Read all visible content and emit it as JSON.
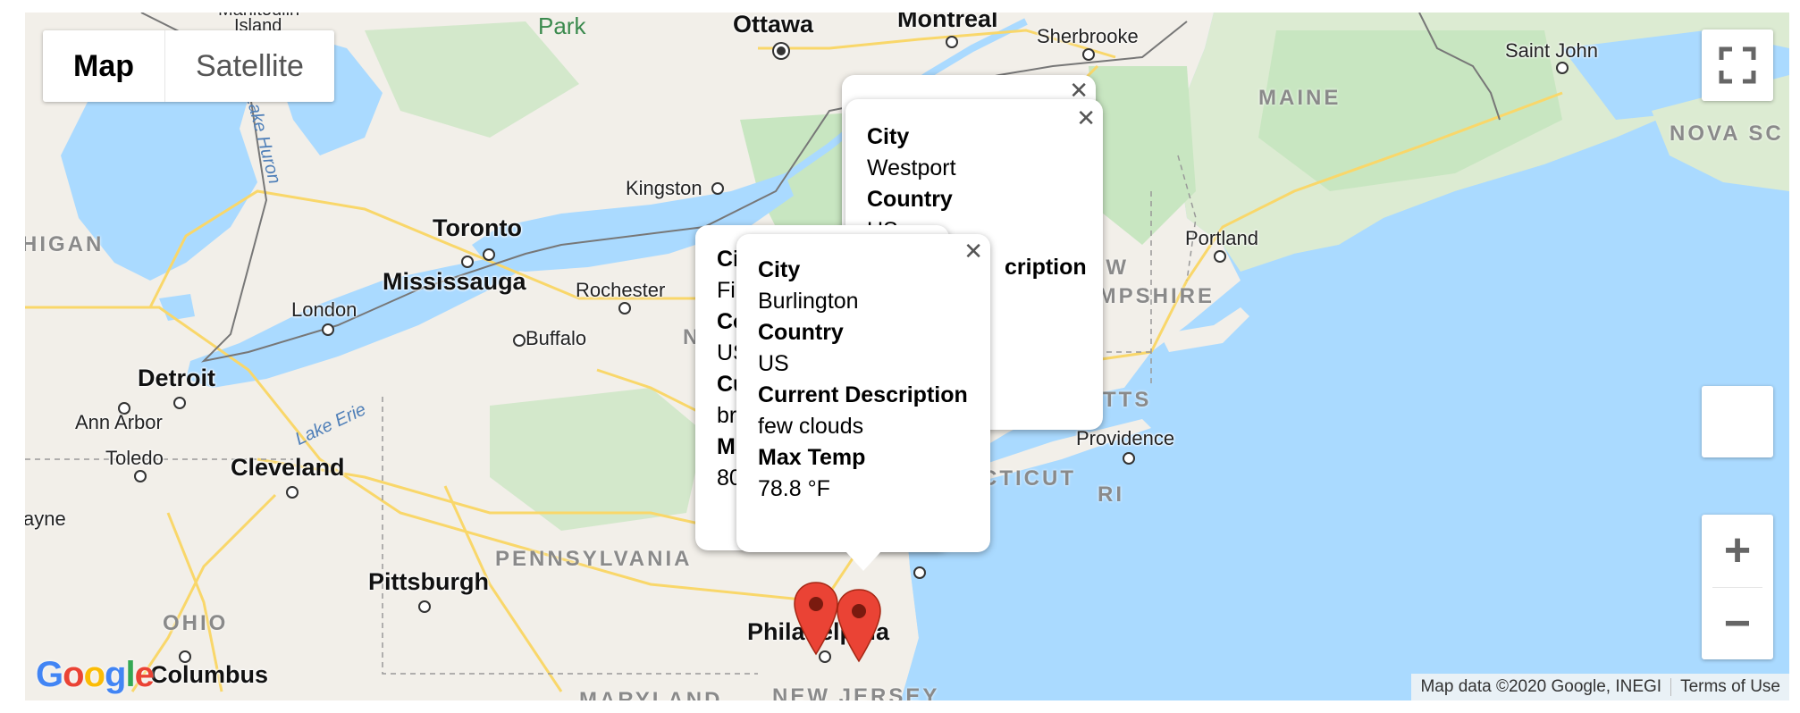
{
  "map_type": {
    "map_label": "Map",
    "satellite_label": "Satellite"
  },
  "places": {
    "ottawa": "Ottawa",
    "montreal": "Montreal",
    "sherbrooke": "Sherbrooke",
    "saint_john": "Saint John",
    "kingston": "Kingston",
    "toronto": "Toronto",
    "mississauga": "Mississauga",
    "rochester": "Rochester",
    "london": "London",
    "buffalo": "Buffalo",
    "detroit": "Detroit",
    "ann_arbor": "Ann Arbor",
    "toledo": "Toledo",
    "cleveland": "Cleveland",
    "pittsburgh": "Pittsburgh",
    "philadelphia": "Philadelphia",
    "columbus": "Columbus",
    "portland": "Portland",
    "providence": "Providence",
    "wayne": "ayne",
    "manitoulin": "Manitoulin",
    "island": "Island"
  },
  "regions": {
    "maine": "MAINE",
    "nova_scotia": "NOVA SC",
    "new_hampshire_1": "NEW",
    "new_hampshire_2": "HAMPSHIRE",
    "massachusetts": "SETTS",
    "connecticut": "CTICUT",
    "ri": "RI",
    "pennsylvania": "PENNSYLVANIA",
    "ohio": "OHIO",
    "michigan": "HIGAN",
    "maryland": "MARYLAND",
    "new_jersey": "NEW JERSEY",
    "ny_fragment": "N"
  },
  "water": {
    "lake_erie": "Lake Erie",
    "lake_huron": "Lake Huron"
  },
  "parks": {
    "park": "Park"
  },
  "info_windows": [
    {
      "city_label": "City",
      "city": "Westport",
      "country_label": "Country",
      "country": "US",
      "desc_label": "Current Description",
      "desc_partial": "cription"
    },
    {
      "city_label": "Ci",
      "city": "Fi",
      "country_label": "Co",
      "country": "US",
      "desc_label": "Cu",
      "desc": "br",
      "temp_label": "M",
      "temp": "80"
    },
    {
      "city_label": "City",
      "city": "Burlington",
      "country_label": "Country",
      "country": "US",
      "desc_label": "Current Description",
      "desc": "few clouds",
      "temp_label": "Max Temp",
      "temp": "78.8 °F"
    }
  ],
  "attribution": {
    "map_data": "Map data ©2020 Google, INEGI",
    "terms": "Terms of Use"
  },
  "logo": {
    "text": "Google"
  },
  "zoom": {
    "in": "+",
    "out": "−"
  },
  "colors": {
    "water": "#aadaff",
    "land": "#f2efe9",
    "forest": "#c8e6c1",
    "marker": "#ea4335",
    "marker_dark": "#a52714"
  },
  "icons": {
    "fullscreen": "fullscreen-icon",
    "pegman": "pegman-icon",
    "close": "close-icon",
    "marker": "map-marker-icon"
  }
}
